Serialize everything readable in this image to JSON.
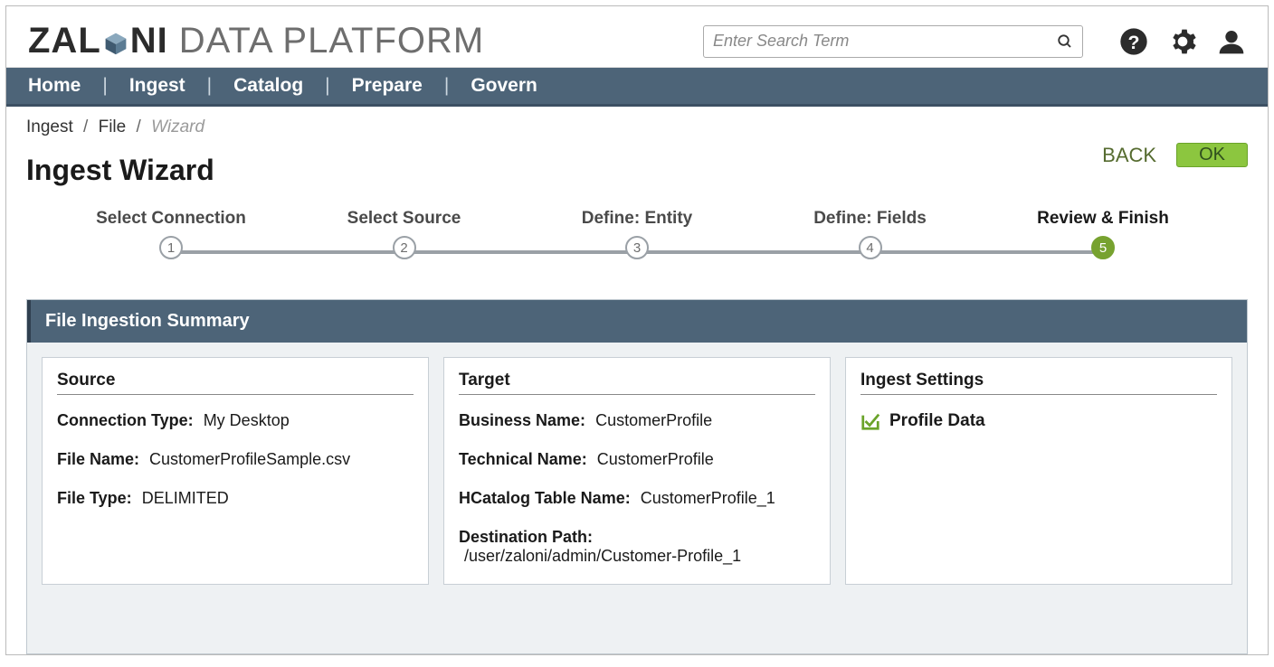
{
  "brand": {
    "name": "ZALONI",
    "suffix": "DATA PLATFORM"
  },
  "search": {
    "placeholder": "Enter Search Term"
  },
  "nav": [
    "Home",
    "Ingest",
    "Catalog",
    "Prepare",
    "Govern"
  ],
  "breadcrumb": {
    "a": "Ingest",
    "b": "File",
    "c": "Wizard"
  },
  "page_title": "Ingest Wizard",
  "actions": {
    "back": "BACK",
    "ok": "OK"
  },
  "stepper": {
    "steps": [
      {
        "num": "1",
        "label": "Select Connection"
      },
      {
        "num": "2",
        "label": "Select Source"
      },
      {
        "num": "3",
        "label": "Define: Entity"
      },
      {
        "num": "4",
        "label": "Define: Fields"
      },
      {
        "num": "5",
        "label": "Review & Finish"
      }
    ],
    "active_index": 4
  },
  "summary": {
    "header": "File Ingestion Summary",
    "source": {
      "title": "Source",
      "connection_type_label": "Connection Type:",
      "connection_type": "My Desktop",
      "file_name_label": "File Name:",
      "file_name": "CustomerProfileSample.csv",
      "file_type_label": "File Type:",
      "file_type": "DELIMITED"
    },
    "target": {
      "title": "Target",
      "business_name_label": "Business Name:",
      "business_name": "CustomerProfile",
      "technical_name_label": "Technical Name:",
      "technical_name": "CustomerProfile",
      "hcatalog_label": "HCatalog Table Name:",
      "hcatalog": "CustomerProfile_1",
      "dest_path_label": "Destination Path:",
      "dest_path": "/user/zaloni/admin/Customer-Profile_1"
    },
    "settings": {
      "title": "Ingest Settings",
      "profile_data": "Profile Data"
    }
  }
}
